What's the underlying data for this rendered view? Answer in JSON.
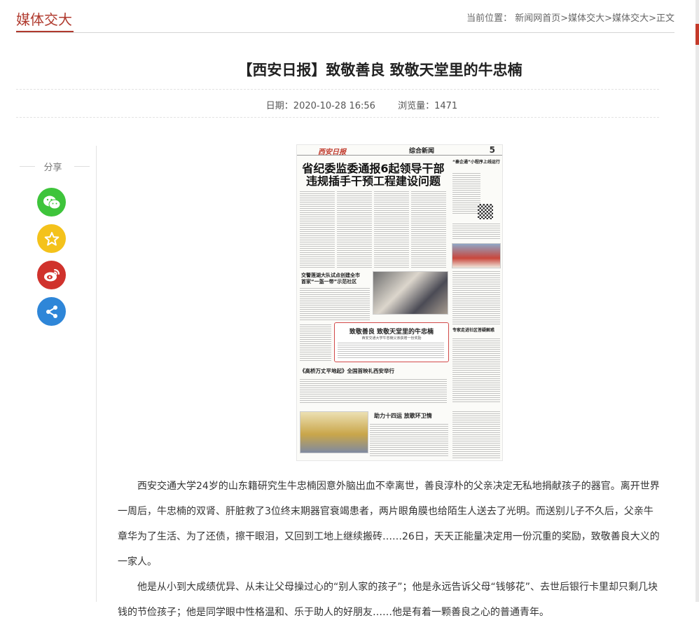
{
  "header": {
    "section_title": "媒体交大",
    "breadcrumb": {
      "prefix": "当前位置：",
      "items": [
        "新闻网首页",
        "媒体交大",
        "媒体交大",
        "正文"
      ],
      "separator": ">"
    }
  },
  "article": {
    "title": "【西安日报】致敬善良 致敬天堂里的牛忠楠",
    "date_label": "日期：",
    "date": "2020-10-28 16:56",
    "views_label": "浏览量：",
    "views": "1471"
  },
  "share": {
    "label": "分享",
    "buttons": [
      {
        "name": "wechat",
        "color": "#3ec43b",
        "icon": "wechat-icon"
      },
      {
        "name": "qzone",
        "color": "#f4c21b",
        "icon": "star-icon"
      },
      {
        "name": "weibo",
        "color": "#d0322c",
        "icon": "weibo-icon"
      },
      {
        "name": "more",
        "color": "#2e86d8",
        "icon": "share-icon"
      }
    ]
  },
  "newspaper": {
    "masthead": "西安日报",
    "section": "综合新闻",
    "page_number": "5",
    "headline_line1": "省纪委监委通报6起领导干部",
    "headline_line2": "违规插手干预工程建设问题",
    "sub1_line1": "交警莲湖大队试点创建全市",
    "sub1_line2": "首家“一盔一带”示范社区",
    "highlight_title": "致敬善良 致敬天堂里的牛忠楠",
    "highlight_sub": "西安交通大学牛忠楠父亲获赠一份奖励",
    "sub2": "《高桥万丈平地起》全国首映礼西安举行",
    "sub3": "助力十四运 放歌环卫情",
    "side1": "“秦企通”小程序上线运行",
    "side2": "专家走进社区答疑解惑"
  },
  "body": {
    "paragraphs": [
      "西安交通大学24岁的山东籍研究生牛忠楠因意外脑出血不幸离世，善良淳朴的父亲决定无私地捐献孩子的器官。离开世界一周后，牛忠楠的双肾、肝脏救了3位终末期器官衰竭患者，两片眼角膜也给陌生人送去了光明。而送别儿子不久后，父亲牛章华为了生活、为了还债，擦干眼泪，又回到工地上继续搬砖……26日，天天正能量决定用一份沉重的奖励，致敬善良大义的一家人。",
      "他是从小到大成绩优异、从未让父母操过心的“别人家的孩子”；他是永远告诉父母“钱够花”、去世后银行卡里却只剩几块钱的节俭孩子；他是同学眼中性格温和、乐于助人的好朋友……他是有着一颗善良之心的普通青年。"
    ]
  }
}
